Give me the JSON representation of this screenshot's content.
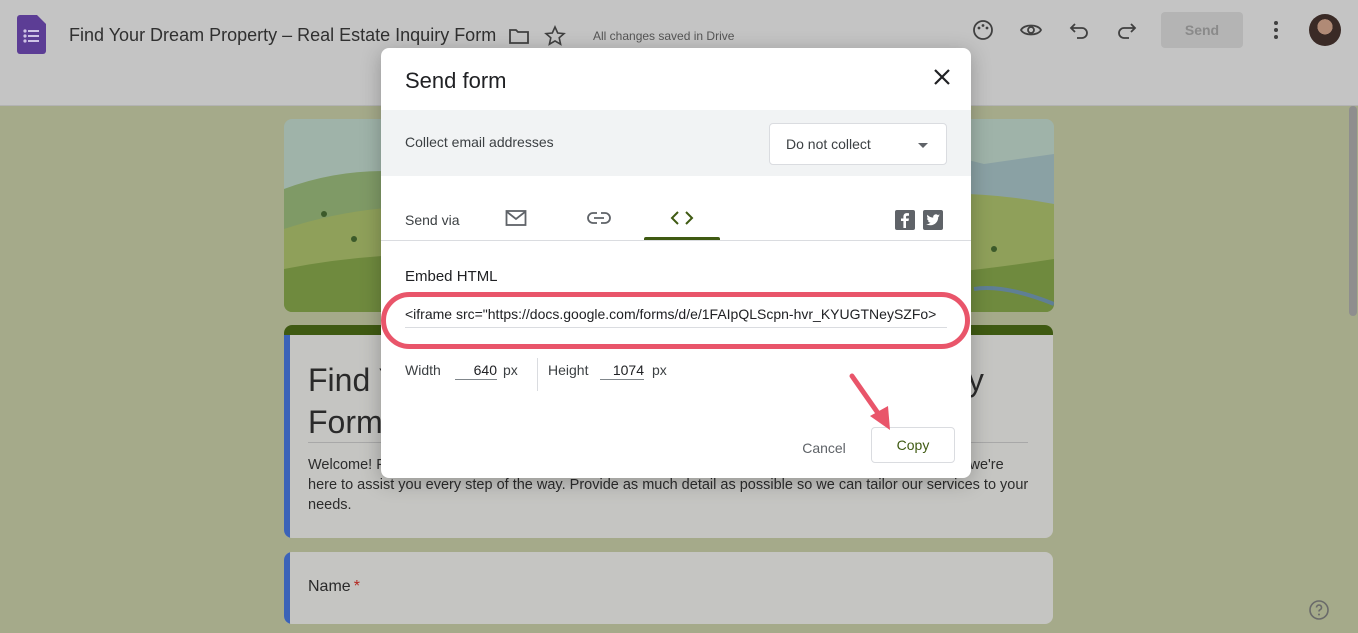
{
  "app": {
    "doc_title": "Find Your Dream Property – Real Estate Inquiry Form",
    "save_status": "All changes saved in Drive",
    "send_label": "Send"
  },
  "form_behind": {
    "title": "Find Your Dream Property – Real Estate Inquiry Form",
    "description": "Welcome! Fill out this form to let us know how we can help. Whether you're looking to buy, sell, or rent, we're here to assist you every step of the way. Provide as much detail as possible so we can tailor our services to your needs.",
    "question_label": "Name",
    "required_mark": "*"
  },
  "dialog": {
    "title": "Send form",
    "collect_label": "Collect email addresses",
    "collect_value": "Do not collect",
    "send_via_label": "Send via",
    "tabs": [
      {
        "icon": "email-icon",
        "active": false
      },
      {
        "icon": "link-icon",
        "active": false
      },
      {
        "icon": "embed-code-icon",
        "active": true
      }
    ],
    "social": [
      "facebook-icon",
      "twitter-icon"
    ],
    "embed_label": "Embed HTML",
    "embed_value": "<iframe src=\"https://docs.google.com/forms/d/e/1FAIpQLScpn-hvr_KYUGTNeySZFo>",
    "width_label": "Width",
    "width_value": "640",
    "height_label": "Height",
    "height_value": "1074",
    "unit": "px",
    "cancel_label": "Cancel",
    "copy_label": "Copy"
  },
  "colors": {
    "accent": "#3f5a12",
    "highlight": "#e9556a",
    "form_blue": "#3b63b8"
  }
}
